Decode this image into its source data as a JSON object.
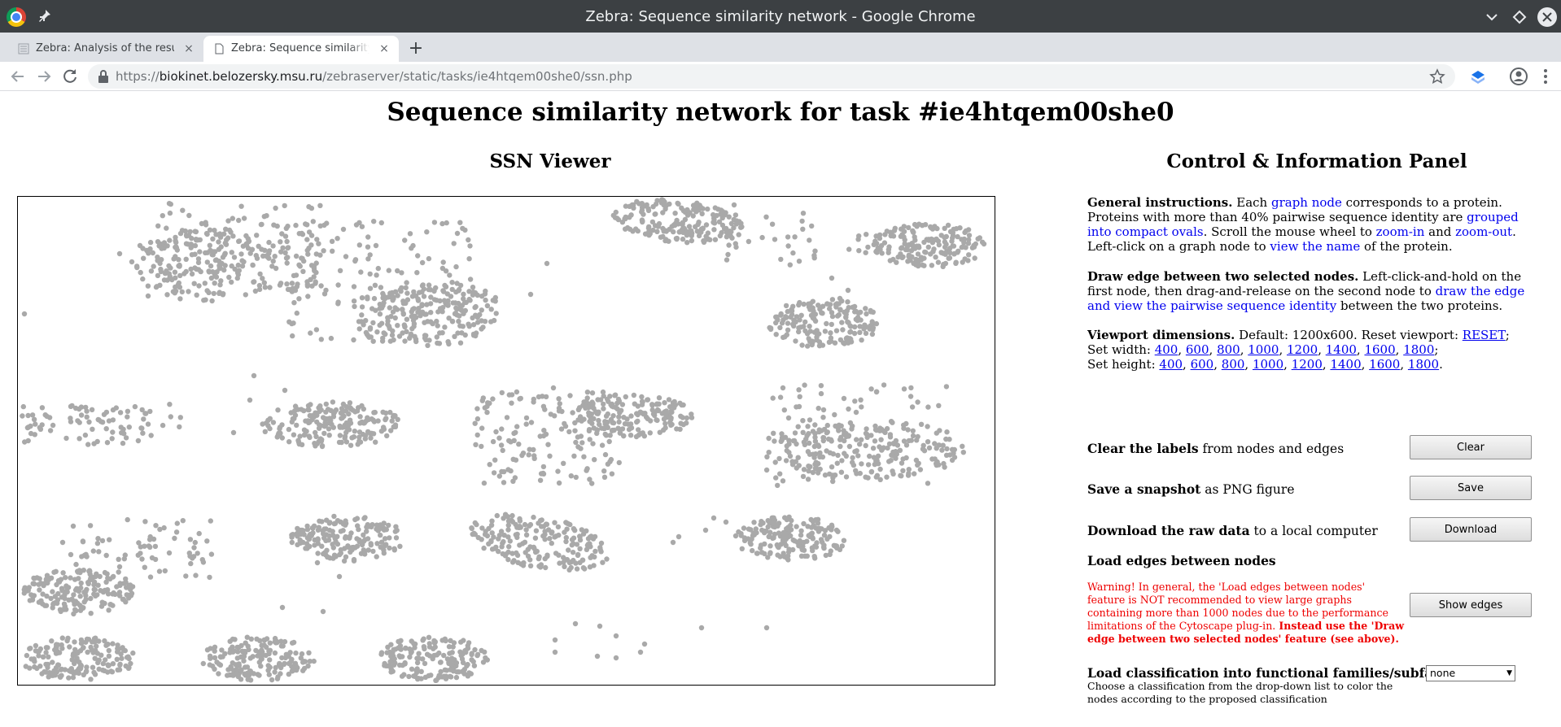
{
  "window": {
    "title": "Zebra: Sequence similarity network - Google Chrome"
  },
  "tabs": [
    {
      "label": "Zebra: Analysis of the results",
      "close": "×"
    },
    {
      "label": "Zebra: Sequence similarity network",
      "close": "×"
    }
  ],
  "new_tab_label": "+",
  "url": {
    "scheme": "https://",
    "host": "biokinet.belozersky.msu.ru",
    "path": "/zebraserver/static/tasks/ie4htqem00she0/ssn.php"
  },
  "page": {
    "title": "Sequence similarity network for task #ie4htqem00she0",
    "viewer_title": "SSN Viewer",
    "panel_title": "Control & Information Panel"
  },
  "general": {
    "heading": "General instructions.",
    "t1": " Each ",
    "l1": "graph node",
    "t2": " corresponds to a protein. Proteins with more than 40% pairwise sequence identity are ",
    "l2": "grouped into compact ovals",
    "t3": ". Scroll the mouse wheel to ",
    "l3": "zoom-in",
    "t4": " and ",
    "l4": "zoom-out",
    "t5": ". Left-click on a graph node to ",
    "l5": "view the name",
    "t6": " of the protein."
  },
  "draw_edge": {
    "heading": "Draw edge between two selected nodes.",
    "t1": " Left-click-and-hold on the first node, then drag-and-release on the second node to ",
    "l1": "draw the edge and view the pairwise sequence identity",
    "t2": " between the two proteins."
  },
  "viewport": {
    "heading": "Viewport dimensions.",
    "default_text": " Default: 1200x600. Reset viewport: ",
    "reset_label": "RESET",
    "width_label": "Set width: ",
    "height_label": "Set height: ",
    "sizes": [
      "400",
      "600",
      "800",
      "1000",
      "1200",
      "1400",
      "1600",
      "1800"
    ]
  },
  "controls": {
    "clear": {
      "bold": "Clear the labels",
      "rest": " from nodes and edges",
      "button": "Clear"
    },
    "save": {
      "bold": "Save a snapshot",
      "rest": " as PNG figure",
      "button": "Save"
    },
    "download": {
      "bold": "Download the raw data",
      "rest": " to a local computer",
      "button": "Download"
    },
    "edges": {
      "heading": "Load edges between nodes",
      "warning": "Warning! In general, the 'Load edges between nodes' feature is NOT recommended to view large graphs containing more than 1000 nodes due to the performance limitations of the Cytoscape plug-in. ",
      "warning_bold": "Instead use the 'Draw edge between two selected nodes' feature (see above).",
      "button": "Show edges"
    },
    "classification": {
      "heading": "Load classification into functional families/subfamilies",
      "selected": "none",
      "note": "Choose a classification from the drop-down list to color the nodes according to the proposed classification"
    }
  },
  "colors": {
    "node": "#a9a9a9",
    "link": "#0000ee",
    "warning": "#ee0000"
  }
}
